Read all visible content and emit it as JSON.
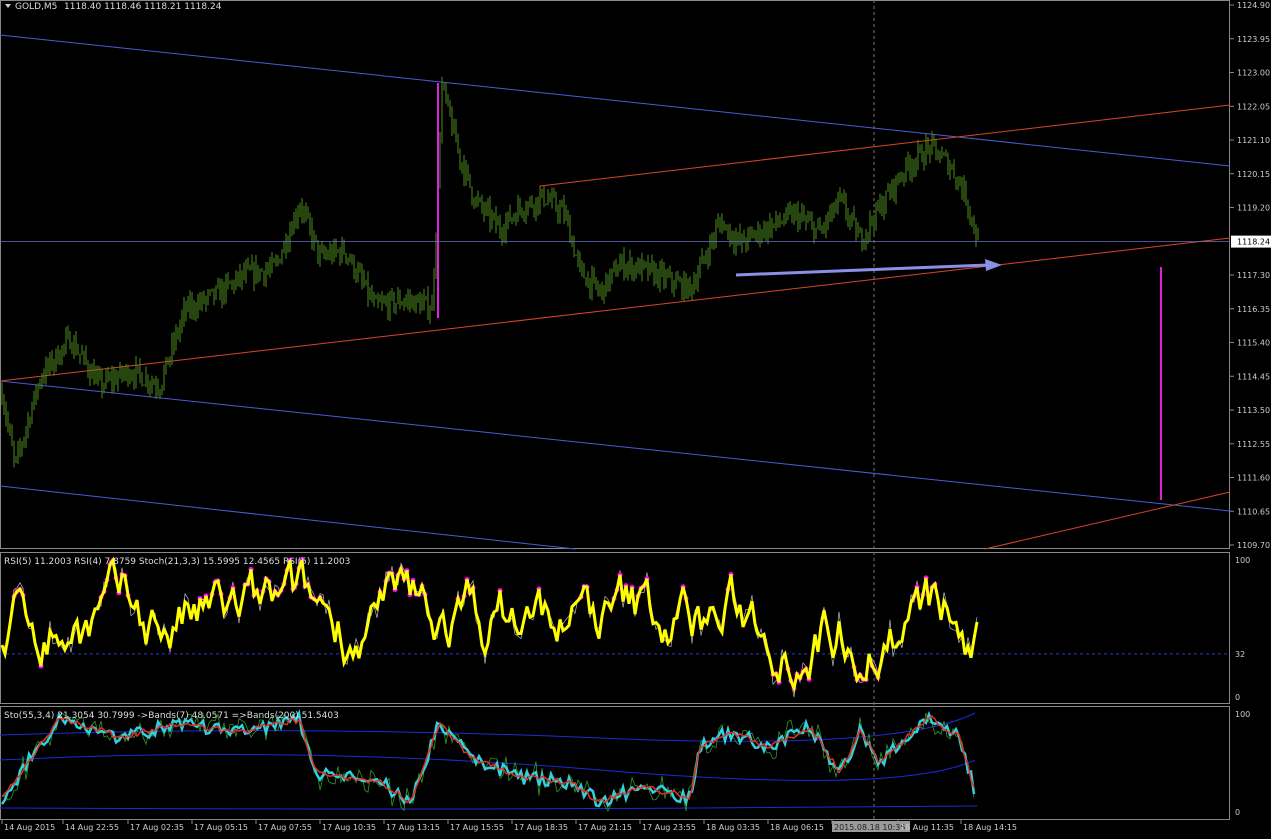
{
  "header": {
    "symbol": "GOLD,M5",
    "ohlc": "1118.40 1118.46 1118.21 1118.24"
  },
  "price_axis": {
    "ticks": [
      "1124.90",
      "1123.95",
      "1123.00",
      "1122.05",
      "1121.10",
      "1120.15",
      "1119.20",
      "1118.24",
      "1117.30",
      "1116.35",
      "1115.40",
      "1114.45",
      "1113.50",
      "1112.55",
      "1111.60",
      "1110.65",
      "1109.70"
    ],
    "current": "1118.24"
  },
  "time_axis": {
    "ticks": [
      "14 Aug 2015",
      "14 Aug 22:55",
      "17 Aug 02:35",
      "17 Aug 05:15",
      "17 Aug 07:55",
      "17 Aug 10:35",
      "17 Aug 13:15",
      "17 Aug 15:55",
      "17 Aug 18:35",
      "17 Aug 21:15",
      "17 Aug 23:55",
      "18 Aug 03:35",
      "18 Aug 06:15",
      "2015.08.18 10:35",
      "18 Aug 11:35",
      "18 Aug 14:15"
    ],
    "highlight": "2015.08.18 10:35"
  },
  "rsi_panel": {
    "label": "RSI(5) 11.2003  RSI(4) 7.8759  Stoch(21,3,3) 15.5995 12.4565  RSI(5) 11.2003",
    "ticks": [
      "100",
      "32",
      "0"
    ]
  },
  "sto_panel": {
    "label": "Sto(55,3,4) 21.3054 30.7999  ->Bands(7) 48.0571  =>Bands(200) 51.5403",
    "ticks": [
      "100",
      "0"
    ]
  },
  "colors": {
    "background": "#000000",
    "candles": "#4b8a1e",
    "channel_blue": "#4a5bd6",
    "channel_red": "#d8452a",
    "magenta": "#e020e0",
    "arrow": "#8a8fe8",
    "rsi_main": "#ffff00",
    "rsi_dots": "#ff00ff"
  },
  "chart_data": [
    {
      "type": "candlestick",
      "title": "GOLD,M5",
      "timeframe": "M5",
      "last": {
        "open": 1118.4,
        "high": 1118.46,
        "low": 1118.21,
        "close": 1118.24
      },
      "ylim": [
        1109.7,
        1124.9
      ],
      "approx_close_path": [
        {
          "t": "14 Aug 2015",
          "v": 1114.0
        },
        {
          "t": "14 Aug 22:55",
          "v": 1114.9
        },
        {
          "t": "17 Aug 02:35",
          "v": 1115.1
        },
        {
          "t": "17 Aug 05:15",
          "v": 1116.8
        },
        {
          "t": "17 Aug 07:55",
          "v": 1118.9
        },
        {
          "t": "17 Aug 10:35",
          "v": 1117.2
        },
        {
          "t": "17 Aug 13:15",
          "v": 1116.6
        },
        {
          "t": "17 Aug 15:55",
          "v": 1120.4
        },
        {
          "t": "17 Aug 18:35",
          "v": 1119.1
        },
        {
          "t": "17 Aug 21:15",
          "v": 1117.0
        },
        {
          "t": "17 Aug 23:55",
          "v": 1117.2
        },
        {
          "t": "18 Aug 03:35",
          "v": 1118.5
        },
        {
          "t": "18 Aug 06:15",
          "v": 1119.0
        },
        {
          "t": "2015.08.18 10:35",
          "v": 1120.0
        },
        {
          "t": "18 Aug 11:35",
          "v": 1120.8
        },
        {
          "t": "18 Aug 14:15",
          "v": 1118.24
        }
      ],
      "indicators": [
        {
          "name": "RSI(5)",
          "value": 11.2003
        },
        {
          "name": "RSI(4)",
          "value": 7.8759
        },
        {
          "name": "Stoch(21,3,3)",
          "values": [
            15.5995,
            12.4565
          ]
        },
        {
          "name": "Sto(55,3,4)",
          "values": [
            21.3054,
            30.7999
          ]
        },
        {
          "name": "Bands(7)",
          "value": 48.0571
        },
        {
          "name": "Bands(200)",
          "value": 51.5403
        }
      ]
    }
  ]
}
